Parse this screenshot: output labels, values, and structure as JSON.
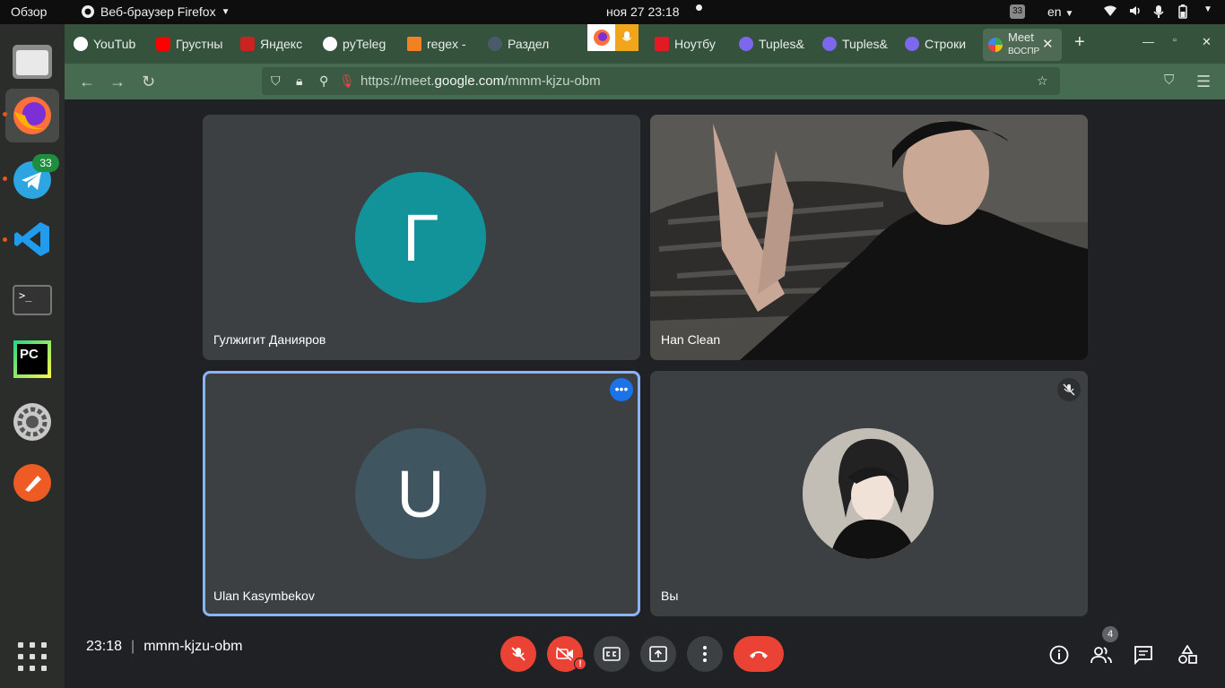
{
  "topbar": {
    "overview": "Обзор",
    "app_menu": "Веб-браузер Firefox",
    "clock": "ноя 27  23:18",
    "notifications": "33",
    "lang": "en"
  },
  "dock": {
    "telegram_badge": "33",
    "terminal_prompt": ">_",
    "pycharm_label": "PC"
  },
  "browser": {
    "tabs": [
      {
        "label": "YouTub",
        "color": "#ffffff"
      },
      {
        "label": "Грустны",
        "color": "#ff0000"
      },
      {
        "label": "Яндекс",
        "color": "#cc2222"
      },
      {
        "label": "pyTeleg",
        "color": "#ffffff"
      },
      {
        "label": "regex -",
        "color": "#f48024"
      },
      {
        "label": "Раздел",
        "color": "#4a5a6a"
      },
      {
        "label": "Ноутбу",
        "color": "#e21b22"
      },
      {
        "label": "Tuples&",
        "color": "#7b68ee"
      },
      {
        "label": "Tuples&",
        "color": "#7b68ee"
      },
      {
        "label": "Строки",
        "color": "#7b68ee"
      }
    ],
    "active_tab": {
      "line1": "Meet",
      "line2": "ВОСПР"
    },
    "url_prefix": "https://meet.",
    "url_domain": "google.com",
    "url_path": "/mmm-kjzu-obm"
  },
  "meet": {
    "participants": [
      {
        "name": "Гулжигит Данияров",
        "initial": "Г",
        "color": "#12939a"
      },
      {
        "name": "Han Clean"
      },
      {
        "name": "Ulan Kasymbekov",
        "initial": "U",
        "color": "#3f5560"
      },
      {
        "name": "Вы"
      }
    ],
    "more_label": "•••",
    "time": "23:18",
    "meeting_code": "mmm-kjzu-obm",
    "camera_alert": "!",
    "people_count": "4"
  }
}
